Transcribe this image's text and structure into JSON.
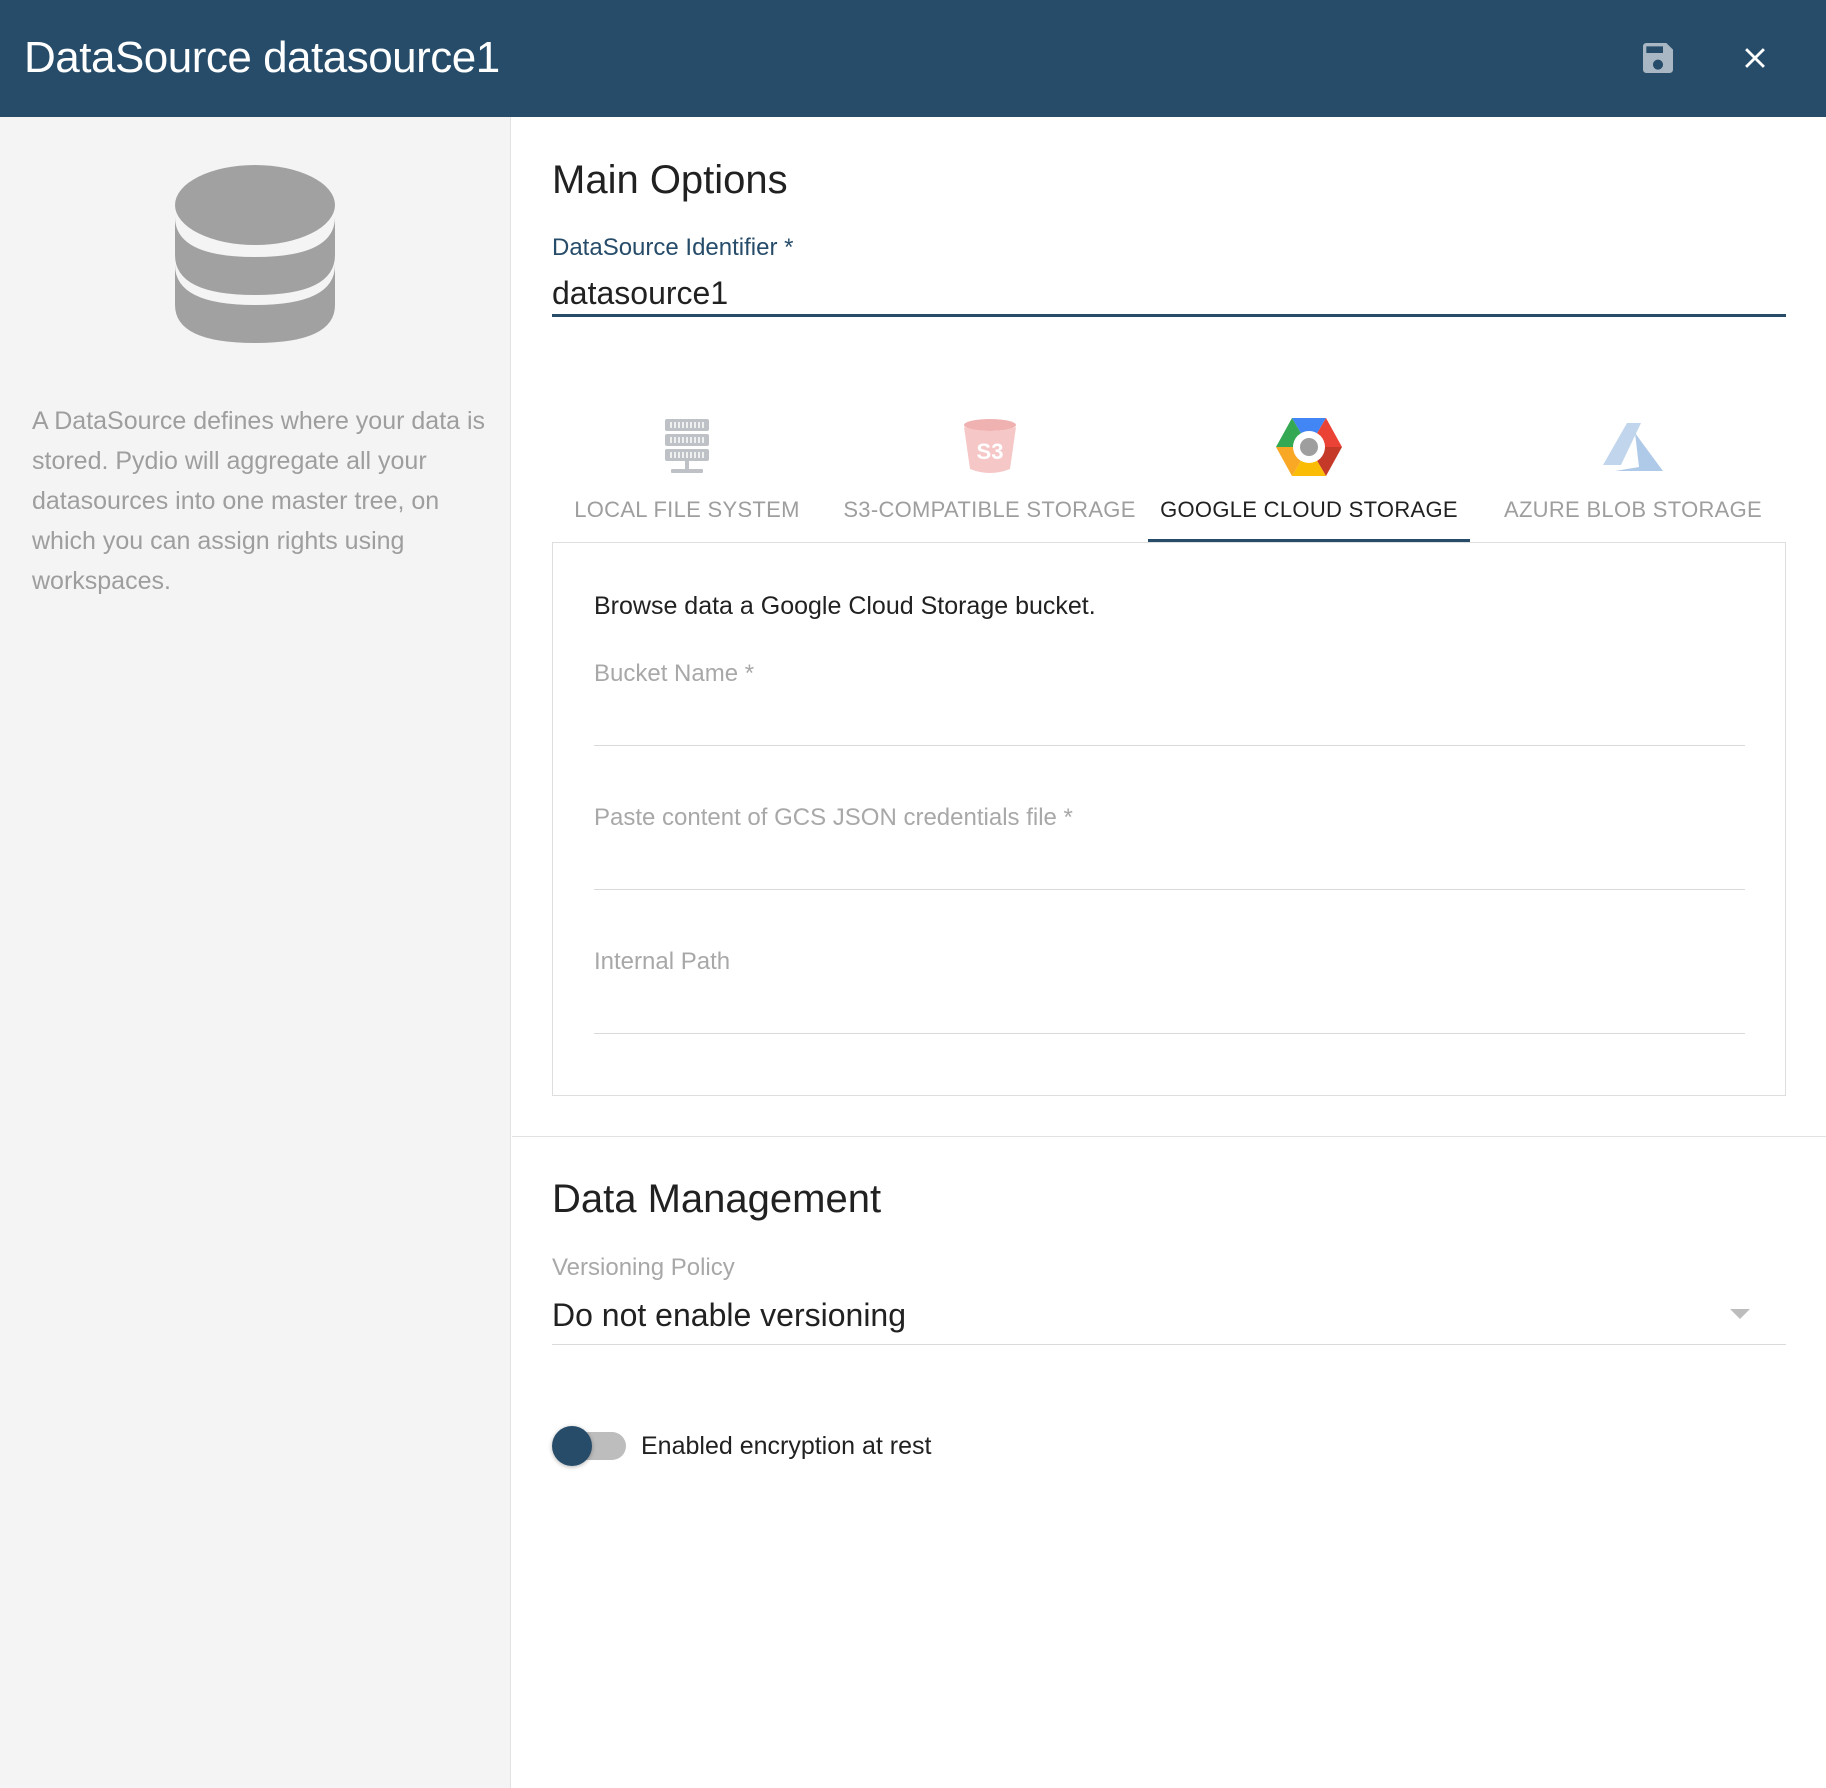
{
  "header": {
    "title": "DataSource datasource1",
    "save_icon": "save-icon",
    "close_icon": "close-icon"
  },
  "sidebar": {
    "icon": "database-icon",
    "description": "A DataSource defines where your data is stored. Pydio will aggregate all your datasources into one master tree, on which you can assign rights using workspaces."
  },
  "main_options": {
    "title": "Main Options",
    "identifier_label": "DataSource Identifier *",
    "identifier_value": "datasource1"
  },
  "storage_tabs": [
    {
      "label": "LOCAL FILE SYSTEM",
      "icon": "server-icon",
      "active": false
    },
    {
      "label": "S3-COMPATIBLE STORAGE",
      "icon": "s3-bucket-icon",
      "active": false
    },
    {
      "label": "GOOGLE CLOUD STORAGE",
      "icon": "google-cloud-icon",
      "active": true
    },
    {
      "label": "AZURE BLOB STORAGE",
      "icon": "azure-icon",
      "active": false
    }
  ],
  "storage_panel": {
    "description": "Browse data a Google Cloud Storage bucket.",
    "fields": [
      {
        "label": "Bucket Name *",
        "value": ""
      },
      {
        "label": "Paste content of GCS JSON credentials file *",
        "value": ""
      },
      {
        "label": "Internal Path",
        "value": ""
      }
    ]
  },
  "data_management": {
    "title": "Data Management",
    "versioning_label": "Versioning Policy",
    "versioning_value": "Do not enable versioning",
    "encryption_label": "Enabled encryption at rest",
    "encryption_enabled": false
  },
  "colors": {
    "primary": "#264c6a",
    "sidebar_bg": "#f4f4f4",
    "muted_text": "#9e9e9e"
  }
}
